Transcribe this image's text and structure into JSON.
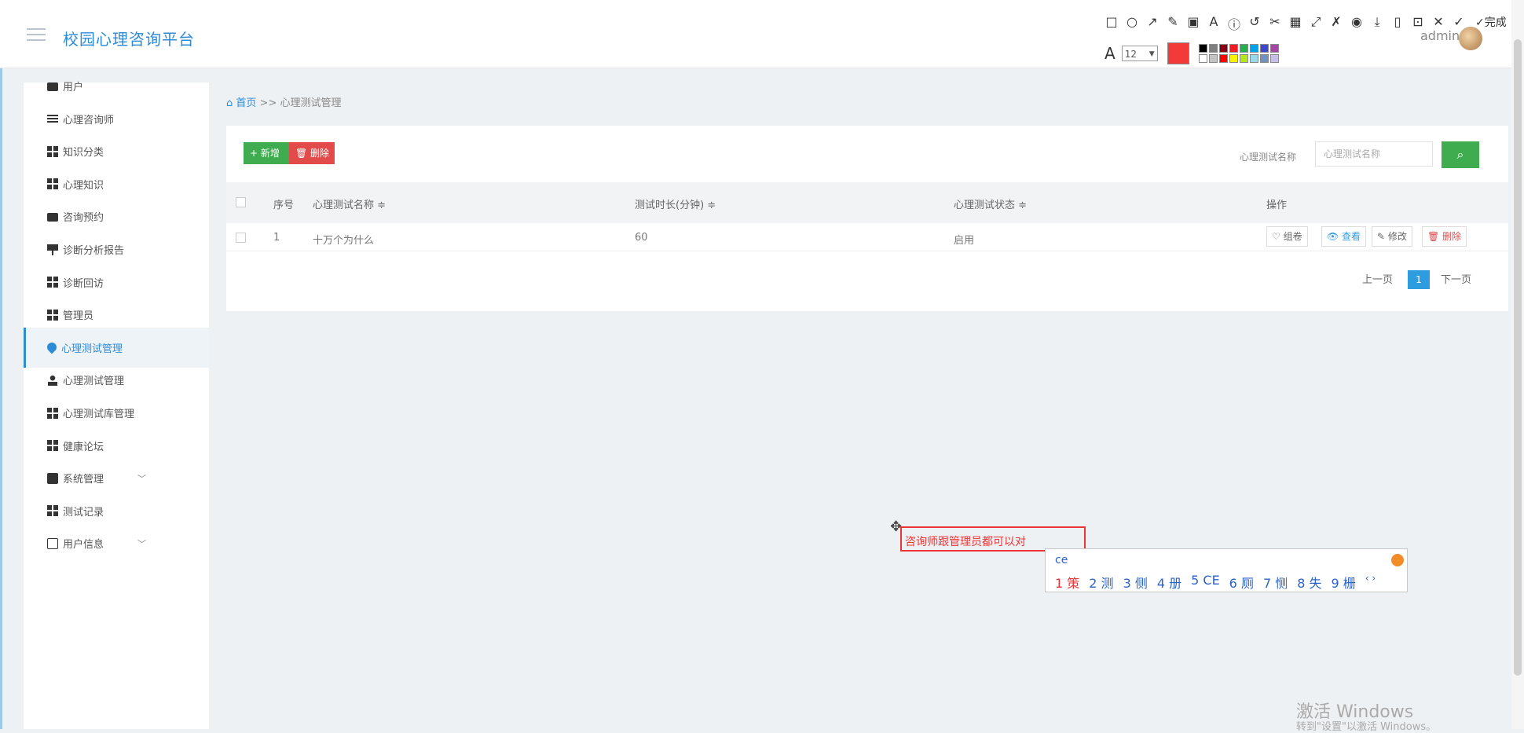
{
  "header": {
    "brand": "校园心理咨询平台",
    "user_name": "admin"
  },
  "screenshot_toolbar": {
    "tools": [
      "□",
      "○",
      "↗",
      "✎",
      "▣",
      "A",
      "ⓘ",
      "↺",
      "✂",
      "▦",
      "⤢",
      "✗",
      "◉",
      "⤓",
      "▯",
      "⊡",
      "✕",
      "✓"
    ],
    "done_label": "✓完成",
    "font_letter": "A",
    "font_size": "12",
    "current_color": "#f23a3a",
    "palette": [
      "#000000",
      "#7f7f7f",
      "#880015",
      "#ed1c24",
      "#22b14c",
      "#00a2e8",
      "#3f48cc",
      "#a349a4",
      "#ffffff",
      "#c3c3c3",
      "#ff0000",
      "#fff200",
      "#b5e61d",
      "#99d9ea",
      "#7092be",
      "#c8bfe7"
    ]
  },
  "sidebar": {
    "items": [
      {
        "label": "用户",
        "icon": "card-icon"
      },
      {
        "label": "心理咨询师",
        "icon": "sliders-icon"
      },
      {
        "label": "知识分类",
        "icon": "grid-icon"
      },
      {
        "label": "心理知识",
        "icon": "grid-icon"
      },
      {
        "label": "咨询预约",
        "icon": "card-icon"
      },
      {
        "label": "诊断分析报告",
        "icon": "board-icon"
      },
      {
        "label": "诊断回访",
        "icon": "grid-icon"
      },
      {
        "label": "管理员",
        "icon": "grid-icon"
      },
      {
        "label": "心理测试管理",
        "icon": "drop-icon",
        "active": true
      },
      {
        "label": "心理测试管理",
        "icon": "user-icon"
      },
      {
        "label": "心理测试库管理",
        "icon": "grid-icon"
      },
      {
        "label": "健康论坛",
        "icon": "grid-icon"
      },
      {
        "label": "系统管理",
        "icon": "gear-icon",
        "expandable": true
      },
      {
        "label": "测试记录",
        "icon": "grid-icon"
      },
      {
        "label": "用户信息",
        "icon": "person-card-icon",
        "expandable": true
      }
    ]
  },
  "breadcrumb": {
    "home": "首页",
    "separator": ">>",
    "current": "心理测试管理"
  },
  "toolbar": {
    "add_label": "+ 新增",
    "delete_label": "🗑 删除"
  },
  "search": {
    "label": "心理测试名称",
    "placeholder": "心理测试名称",
    "button_icon": "search-icon"
  },
  "table": {
    "headers": [
      "序号",
      "心理测试名称 ≑",
      "测试时长(分钟) ≑",
      "心理测试状态 ≑",
      "操作"
    ],
    "rows": [
      {
        "index": "1",
        "name": "十万个为什么",
        "duration": "60",
        "status": "启用"
      }
    ],
    "actions": [
      "♡ 组卷",
      "👁 查看",
      "✎ 修改",
      "🗑 删除"
    ]
  },
  "pagination": {
    "prev": "上一页",
    "current": "1",
    "next": "下一页"
  },
  "annotation": {
    "text": "咨询师跟管理员都可以对",
    "color": "#e33333"
  },
  "ime": {
    "composition": "ce",
    "candidates": [
      "1 策",
      "2 测",
      "3 侧",
      "4 册",
      "5 CE",
      "6 厕",
      "7 恻",
      "8 失",
      "9 栅"
    ],
    "nav": "‹ ›"
  },
  "watermark": {
    "title": "激活 Windows",
    "subtitle": "转到\"设置\"以激活 Windows。"
  }
}
